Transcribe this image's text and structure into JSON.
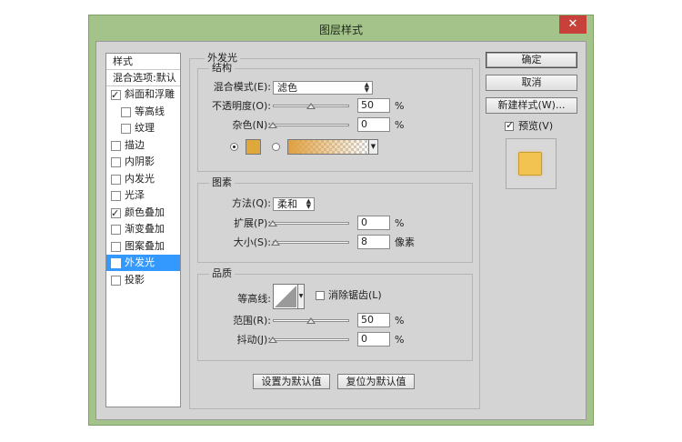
{
  "window": {
    "title": "图层样式",
    "close_glyph": "✕"
  },
  "sidebar": {
    "header": "样式",
    "blend_default": "混合选项:默认",
    "items": [
      {
        "label": "斜面和浮雕",
        "checked": true,
        "indent": 0
      },
      {
        "label": "等高线",
        "checked": false,
        "indent": 1
      },
      {
        "label": "纹理",
        "checked": false,
        "indent": 1
      },
      {
        "label": "描边",
        "checked": false,
        "indent": 0
      },
      {
        "label": "内阴影",
        "checked": false,
        "indent": 0
      },
      {
        "label": "内发光",
        "checked": false,
        "indent": 0
      },
      {
        "label": "光泽",
        "checked": false,
        "indent": 0
      },
      {
        "label": "颜色叠加",
        "checked": true,
        "indent": 0
      },
      {
        "label": "渐变叠加",
        "checked": false,
        "indent": 0
      },
      {
        "label": "图案叠加",
        "checked": false,
        "indent": 0
      },
      {
        "label": "外发光",
        "checked": true,
        "indent": 0,
        "selected": true
      },
      {
        "label": "投影",
        "checked": false,
        "indent": 0
      }
    ]
  },
  "panel": {
    "title": "外发光",
    "structure": {
      "title": "结构",
      "blend_mode_label": "混合模式(E):",
      "blend_mode_value": "滤色",
      "opacity_label": "不透明度(O):",
      "opacity_value": "50",
      "opacity_unit": "%",
      "opacity_fraction": 0.5,
      "noise_label": "杂色(N):",
      "noise_value": "0",
      "noise_unit": "%",
      "noise_fraction": 0.0,
      "color_swatch": "#e0a83a",
      "gradient_start": "#e0a040"
    },
    "elements": {
      "title": "图素",
      "method_label": "方法(Q):",
      "method_value": "柔和",
      "spread_label": "扩展(P):",
      "spread_value": "0",
      "spread_unit": "%",
      "spread_fraction": 0.0,
      "size_label": "大小(S):",
      "size_value": "8",
      "size_unit": "像素",
      "size_fraction": 0.03
    },
    "quality": {
      "title": "品质",
      "contour_label": "等高线:",
      "antialias_label": "消除锯齿(L)",
      "range_label": "范围(R):",
      "range_value": "50",
      "range_unit": "%",
      "range_fraction": 0.5,
      "jitter_label": "抖动(J):",
      "jitter_value": "0",
      "jitter_unit": "%",
      "jitter_fraction": 0.0
    },
    "set_default_label": "设置为默认值",
    "reset_default_label": "复位为默认值"
  },
  "actions": {
    "ok_label": "确定",
    "cancel_label": "取消",
    "new_style_label": "新建样式(W)...",
    "preview_label": "预览(V)",
    "preview_checked": true,
    "preview_color": "#f3c352"
  }
}
